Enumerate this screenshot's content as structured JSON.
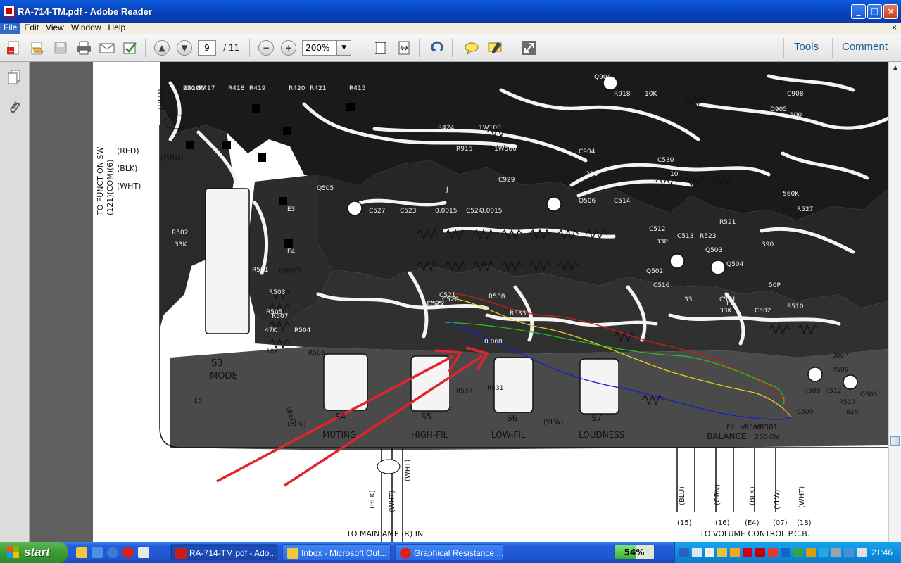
{
  "window": {
    "title": "RA-714-TM.pdf - Adobe Reader"
  },
  "menu": {
    "items": [
      "File",
      "Edit",
      "View",
      "Window",
      "Help"
    ],
    "close": "×"
  },
  "toolbar": {
    "page_current": "9",
    "page_total": "/ 11",
    "zoom": "200%",
    "tools_label": "Tools",
    "comment_label": "Comment"
  },
  "schematic": {
    "left_labels": [
      "TO FUNCTION SW",
      "(121)(COM)(6)",
      "(RED)",
      "(BLK)",
      "(WHT)",
      "(GRN)",
      "(BLU)"
    ],
    "components": [
      "R416",
      "R417",
      "R418",
      "R419",
      "R420",
      "R421",
      "R415",
      "R424",
      "1W100",
      "R915",
      "1W560",
      "R918",
      "10K",
      "C908",
      "100",
      "D905",
      "Q904",
      "C904",
      "220",
      "C929",
      "C530",
      "10",
      "J",
      "Q505",
      "C527",
      "C523",
      "0.0015",
      "C524",
      "0.0015",
      "Q506",
      "C514",
      "C512",
      "C513",
      "33P",
      "R523",
      "R521",
      "560K",
      "R527",
      "390",
      "Q503",
      "Q504",
      "Q502",
      "C516",
      "33",
      "C511",
      "50P",
      "R510",
      "33K",
      "C502",
      "300P",
      "R509",
      "R508",
      "R512",
      "82K",
      "R517",
      "C509",
      "Q508",
      "R502",
      "33K",
      "R501",
      "R503",
      "R505",
      "R507",
      "47K",
      "R504",
      "10K",
      "R506",
      "R537",
      "R531",
      "R533",
      "R538",
      "C525",
      "C522",
      "0.068",
      "C520",
      "C521",
      "E3",
      "E4",
      "E5",
      "E6",
      "E7",
      "VR501",
      "250KW"
    ],
    "labels": {
      "s3": "S3",
      "mode": "MODE",
      "muting": "MUTING",
      "s4": "S4",
      "s5": "S5",
      "high_fil": "HIGH-FIL",
      "s6": "S6",
      "low_fil": "LOW-FIL",
      "s7": "S7",
      "loudness": "LOUDNESS",
      "balance": "BALANCE",
      "vr": "VR501",
      "vr_val": "250KW",
      "ylw": "(YLW)",
      "blk_e6": "(BLK)",
      "red_e6": "(RED)",
      "bottom_blk": "(BLK)",
      "bottom_wht": "(WHT)",
      "bottom_wht2": "(WHT)",
      "main_amp": "TO MAIN AMP (R) IN",
      "vol_blu": "(BLU)",
      "vol_grn": "(GRN)",
      "vol_blk": "(BLK)",
      "vol_ylw": "(YLW)",
      "vol_wht": "(WHT)",
      "n15": "(15)",
      "n16": "(16)",
      "ne4": "(E4)",
      "n07": "(07)",
      "n18": "(18)",
      "to_volume": "TO VOLUME CONTROL P.C.B.",
      "whtE5": "(WHT)"
    }
  },
  "taskbar": {
    "start_label": "start",
    "items": [
      {
        "label": "RA-714-TM.pdf - Ado...",
        "active": true
      },
      {
        "label": "Inbox - Microsoft Out...",
        "active": false
      },
      {
        "label": "Graphical Resistance ...",
        "active": false
      }
    ],
    "meter": "54%",
    "meter_value": 0.54,
    "clock": "21:46"
  },
  "colors": {
    "trace_red": "#d81818",
    "trace_yellow": "#e8d020",
    "trace_green": "#28c020",
    "trace_blue": "#1020d0",
    "arrow_red": "#e0242c"
  }
}
